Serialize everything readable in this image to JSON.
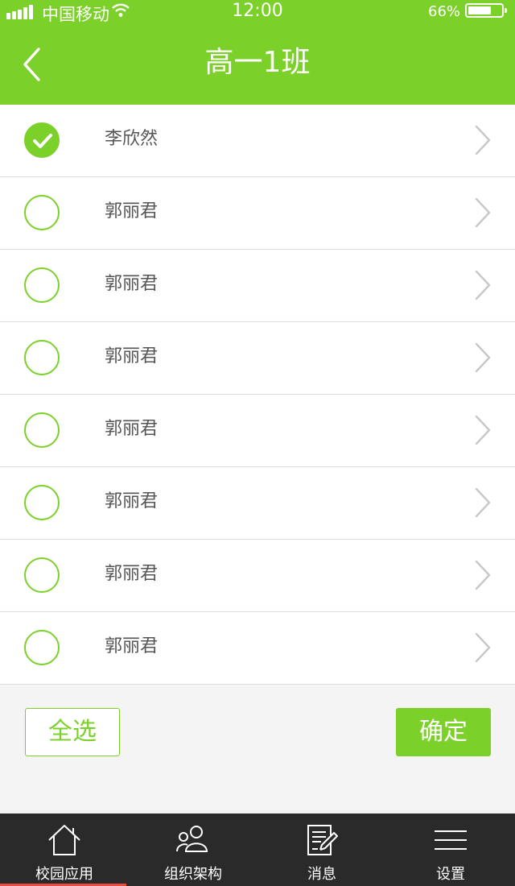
{
  "status_bar": {
    "carrier": "中国移动",
    "time": "12:00",
    "battery_percent": "66%",
    "battery_level": 0.66
  },
  "header": {
    "title": "高一1班",
    "back_icon": "chevron-left-icon"
  },
  "students": [
    {
      "name": "李欣然",
      "checked": true
    },
    {
      "name": "郭丽君",
      "checked": false
    },
    {
      "name": "郭丽君",
      "checked": false
    },
    {
      "name": "郭丽君",
      "checked": false
    },
    {
      "name": "郭丽君",
      "checked": false
    },
    {
      "name": "郭丽君",
      "checked": false
    },
    {
      "name": "郭丽君",
      "checked": false
    },
    {
      "name": "郭丽君",
      "checked": false
    }
  ],
  "actions": {
    "select_all_label": "全选",
    "confirm_label": "确定"
  },
  "tabbar": {
    "tabs": [
      {
        "label": "校园应用",
        "icon": "home-icon",
        "active": true
      },
      {
        "label": "组织架构",
        "icon": "people-icon",
        "active": false
      },
      {
        "label": "消息",
        "icon": "message-icon",
        "active": false
      },
      {
        "label": "设置",
        "icon": "menu-icon",
        "active": false
      }
    ]
  },
  "colors": {
    "accent": "#7cd02a",
    "tabbar_bg": "#2a2a2a",
    "active_tab_indicator": "#e74c3c"
  }
}
